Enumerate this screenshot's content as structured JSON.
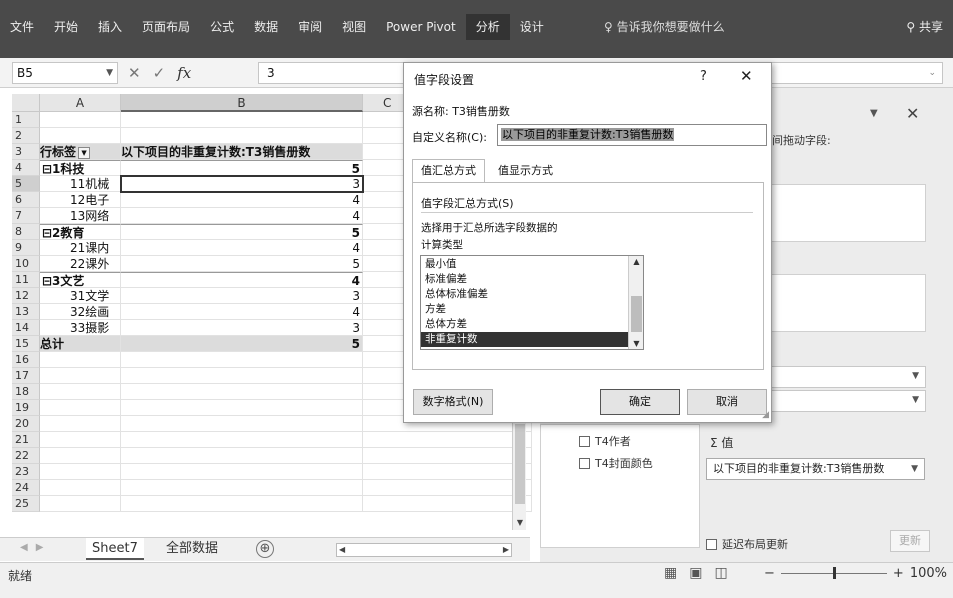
{
  "ribbon": {
    "tabs": [
      "文件",
      "开始",
      "插入",
      "页面布局",
      "公式",
      "数据",
      "审阅",
      "视图",
      "Power Pivot",
      "分析",
      "设计"
    ],
    "active_tab": "分析",
    "tell_me": "告诉我你想要做什么",
    "share": "共享"
  },
  "formula_bar": {
    "name_box": "B5",
    "cancel_icon": "✕",
    "enter_icon": "✓",
    "fx": "fx",
    "value": "3"
  },
  "grid": {
    "columns": [
      "A",
      "B",
      "C"
    ],
    "row_numbers": [
      "1",
      "2",
      "3",
      "4",
      "5",
      "6",
      "7",
      "8",
      "9",
      "10",
      "11",
      "12",
      "13",
      "14",
      "15",
      "16",
      "17",
      "18",
      "19",
      "20",
      "21",
      "22",
      "23",
      "24",
      "25"
    ],
    "header_row": {
      "a": "行标签",
      "b": "以下项目的非重复计数:T3销售册数"
    },
    "pivot_rows": [
      {
        "label": "⊟1科技",
        "value": "5",
        "bold": true
      },
      {
        "label": "11机械",
        "value": "3",
        "bold": false
      },
      {
        "label": "12电子",
        "value": "4",
        "bold": false
      },
      {
        "label": "13网络",
        "value": "4",
        "bold": false
      },
      {
        "label": "⊟2教育",
        "value": "5",
        "bold": true
      },
      {
        "label": "21课内",
        "value": "4",
        "bold": false
      },
      {
        "label": "22课外",
        "value": "5",
        "bold": false
      },
      {
        "label": "⊟3文艺",
        "value": "4",
        "bold": true
      },
      {
        "label": "31文学",
        "value": "3",
        "bold": false
      },
      {
        "label": "32绘画",
        "value": "4",
        "bold": false
      },
      {
        "label": "33摄影",
        "value": "3",
        "bold": false
      }
    ],
    "total": {
      "label": "总计",
      "value": "5"
    }
  },
  "sheet_tabs": {
    "sheets": [
      "Sheet7",
      "全部数据"
    ],
    "active": "Sheet7",
    "add_icon": "⊕"
  },
  "status_bar": {
    "ready": "就绪",
    "zoom": "100%"
  },
  "task_pane": {
    "hint": "间拖动字段:",
    "fields": [
      "T4作者",
      "T4封面颜色"
    ],
    "values_label": "Σ 值",
    "values_item": "以下项目的非重复计数:T3销售册数",
    "defer_update": "延迟布局更新",
    "update_button": "更新"
  },
  "dialog": {
    "title": "值字段设置",
    "help": "?",
    "close": "✕",
    "source_name": "源名称:  T3销售册数",
    "custom_name_label": "自定义名称(C):",
    "custom_name_value": "以下项目的非重复计数:T3销售册数",
    "tab_summarize": "值汇总方式",
    "tab_show_as": "值显示方式",
    "section_title": "值字段汇总方式(S)",
    "description": "选择用于汇总所选字段数据的",
    "calc_type_label": "计算类型",
    "calc_options": [
      "最小值",
      "标准偏差",
      "总体标准偏差",
      "方差",
      "总体方差",
      "非重复计数"
    ],
    "selected_option": "非重复计数",
    "number_format_button": "数字格式(N)",
    "ok_button": "确定",
    "cancel_button": "取消"
  }
}
